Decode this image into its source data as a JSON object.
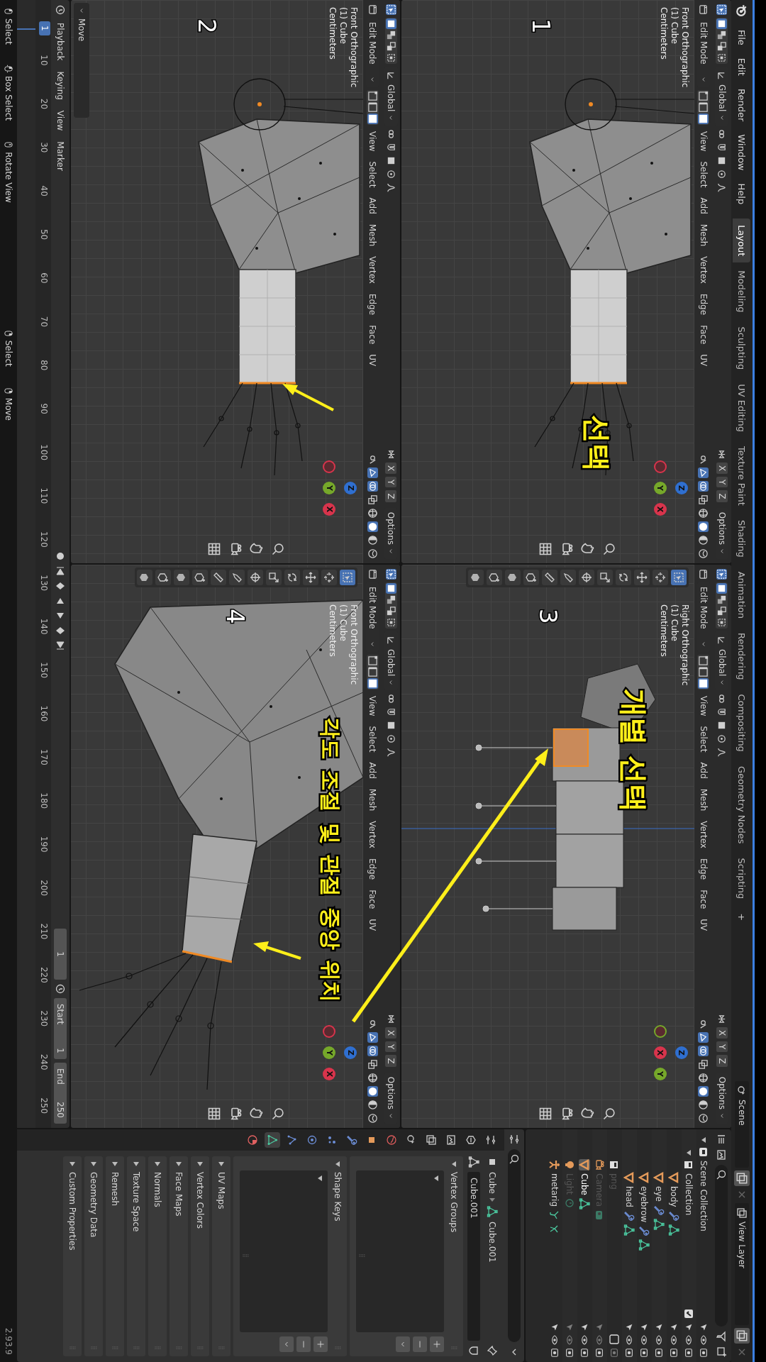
{
  "topbar": {
    "menus": [
      "File",
      "Edit",
      "Render",
      "Window",
      "Help"
    ],
    "workspaces": [
      {
        "label": "Layout",
        "selected": true
      },
      {
        "label": "Modeling",
        "selected": false
      },
      {
        "label": "Sculpting",
        "selected": false
      },
      {
        "label": "UV Editing",
        "selected": false
      },
      {
        "label": "Texture Paint",
        "selected": false
      },
      {
        "label": "Shading",
        "selected": false
      },
      {
        "label": "Animation",
        "selected": false
      },
      {
        "label": "Rendering",
        "selected": false
      },
      {
        "label": "Compositing",
        "selected": false
      },
      {
        "label": "Geometry Nodes",
        "selected": false
      },
      {
        "label": "Scripting",
        "selected": false
      }
    ],
    "add_workspace": "+",
    "scene": "Scene",
    "view_layer": "View Layer"
  },
  "viewports": [
    {
      "kind": "front",
      "number": "1",
      "view": "Front Orthographic",
      "object": "(1) Cube",
      "units": "Centimeters",
      "mode": "Edit Mode",
      "orientation": "Global",
      "options": "Options",
      "mirror_axes": [
        "X",
        "Y",
        "Z"
      ],
      "menus": [
        "View",
        "Select",
        "Add",
        "Mesh",
        "Vertex",
        "Edge",
        "Face",
        "UV"
      ],
      "select_modes": [
        {
          "kind": "vertex",
          "selected": false
        },
        {
          "kind": "edge",
          "selected": false
        },
        {
          "kind": "face",
          "selected": true
        }
      ],
      "shading": [
        {
          "kind": "wireframe",
          "selected": false
        },
        {
          "kind": "solid",
          "selected": true
        },
        {
          "kind": "material",
          "selected": false
        },
        {
          "kind": "rendered",
          "selected": false
        }
      ],
      "gizmo": [
        {
          "label": "Z",
          "kind": "up",
          "color": "#2f6fd0"
        },
        {
          "label": "Y",
          "kind": "center",
          "color": "#76a82a"
        },
        {
          "label": "X",
          "kind": "right",
          "color": "#d8344c"
        }
      ],
      "toolbar": false,
      "annotation": "선택"
    },
    {
      "kind": "right",
      "number": "3",
      "view": "Right Orthographic",
      "object": "(1) Cube",
      "units": "Centimeters",
      "mode": "Edit Mode",
      "orientation": "Global",
      "options": "Options",
      "mirror_axes": [
        "X",
        "Y",
        "Z"
      ],
      "menus": [
        "View",
        "Select",
        "Add",
        "Mesh",
        "Vertex",
        "Edge",
        "Face",
        "UV"
      ],
      "select_modes": [
        {
          "kind": "vertex",
          "selected": false
        },
        {
          "kind": "edge",
          "selected": false
        },
        {
          "kind": "face",
          "selected": true
        }
      ],
      "shading": [
        {
          "kind": "wireframe",
          "selected": false
        },
        {
          "kind": "solid",
          "selected": true
        },
        {
          "kind": "material",
          "selected": false
        },
        {
          "kind": "rendered",
          "selected": false
        }
      ],
      "gizmo": [
        {
          "label": "Z",
          "kind": "up",
          "color": "#2f6fd0"
        },
        {
          "label": "X",
          "kind": "center",
          "color": "#d8344c"
        },
        {
          "label": "Y",
          "kind": "right",
          "color": "#76a82a"
        }
      ],
      "toolbar": true,
      "annotation": "개별 선택"
    },
    {
      "kind": "front",
      "number": "2",
      "view": "Front Orthographic",
      "object": "(1) Cube",
      "units": "Centimeters",
      "mode": "Edit Mode",
      "orientation": "Global",
      "options": "Options",
      "mirror_axes": [
        "X",
        "Y",
        "Z"
      ],
      "menus": [
        "View",
        "Select",
        "Add",
        "Mesh",
        "Vertex",
        "Edge",
        "Face",
        "UV"
      ],
      "select_modes": [
        {
          "kind": "vertex",
          "selected": false
        },
        {
          "kind": "edge",
          "selected": false
        },
        {
          "kind": "face",
          "selected": true
        }
      ],
      "shading": [
        {
          "kind": "wireframe",
          "selected": false
        },
        {
          "kind": "solid",
          "selected": true
        },
        {
          "kind": "material",
          "selected": false
        },
        {
          "kind": "rendered",
          "selected": false
        }
      ],
      "gizmo": [
        {
          "label": "Z",
          "kind": "up",
          "color": "#2f6fd0"
        },
        {
          "label": "Y",
          "kind": "center",
          "color": "#76a82a"
        },
        {
          "label": "X",
          "kind": "right",
          "color": "#d8344c"
        }
      ],
      "toolbar": false,
      "operator_panel": "Move"
    },
    {
      "kind": "close",
      "number": "4",
      "view": "Front Orthographic",
      "object": "(1) Cube",
      "units": "Centimeters",
      "mode": "Edit Mode",
      "orientation": "Global",
      "options": "Options",
      "mirror_axes": [
        "X",
        "Y",
        "Z"
      ],
      "menus": [
        "View",
        "Select",
        "Add",
        "Mesh",
        "Vertex",
        "Edge",
        "Face",
        "UV"
      ],
      "select_modes": [
        {
          "kind": "vertex",
          "selected": false
        },
        {
          "kind": "edge",
          "selected": false
        },
        {
          "kind": "face",
          "selected": true
        }
      ],
      "shading": [
        {
          "kind": "wireframe",
          "selected": false
        },
        {
          "kind": "solid",
          "selected": true
        },
        {
          "kind": "material",
          "selected": false
        },
        {
          "kind": "rendered",
          "selected": false
        }
      ],
      "gizmo": [
        {
          "label": "Z",
          "kind": "up",
          "color": "#2f6fd0"
        },
        {
          "label": "Y",
          "kind": "center",
          "color": "#76a82a"
        },
        {
          "label": "X",
          "kind": "right",
          "color": "#d8344c"
        }
      ],
      "toolbar": true,
      "annotation": "각도 조절 및 관절 중앙 위치"
    }
  ],
  "timeline": {
    "menus": [
      "Playback",
      "Keying",
      "View",
      "Marker"
    ],
    "current_frame": "1",
    "start_label": "Start",
    "start": "1",
    "end_label": "End",
    "end": "250",
    "playhead": "1",
    "ruler": [
      "10",
      "20",
      "30",
      "40",
      "50",
      "60",
      "70",
      "80",
      "90",
      "100",
      "110",
      "120",
      "130",
      "140",
      "150",
      "160",
      "170",
      "180",
      "190",
      "200",
      "210",
      "220",
      "230",
      "240",
      "250"
    ]
  },
  "outliner": {
    "tree": [
      {
        "label": "Scene Collection",
        "kind": "scene",
        "selected": false,
        "children": [
          {
            "label": "Collection",
            "kind": "collection",
            "selected": false,
            "checked": true,
            "children": [
              {
                "label": "body",
                "kind": "mesh",
                "selected": false,
                "disabled": false
              },
              {
                "label": "eye",
                "kind": "mesh",
                "selected": false,
                "disabled": false
              },
              {
                "label": "eyebrow",
                "kind": "mesh",
                "selected": false,
                "disabled": false
              },
              {
                "label": "head",
                "kind": "mesh",
                "selected": false,
                "disabled": false
              }
            ]
          },
          {
            "label": "png",
            "kind": "collection",
            "selected": false,
            "checked": false
          },
          {
            "label": "Camera",
            "kind": "camera",
            "selected": false,
            "disabled": true
          },
          {
            "label": "Cube",
            "kind": "cube",
            "selected": true,
            "disabled": false
          },
          {
            "label": "Light",
            "kind": "light",
            "selected": false,
            "disabled": true
          },
          {
            "label": "metarig",
            "kind": "armature",
            "selected": false,
            "disabled": false
          }
        ]
      }
    ]
  },
  "properties": {
    "tabs": [
      {
        "kind": "tool",
        "selected": false
      },
      {
        "kind": "render",
        "selected": false
      },
      {
        "kind": "output",
        "selected": false
      },
      {
        "kind": "view-layer",
        "selected": false
      },
      {
        "kind": "scene",
        "selected": false
      },
      {
        "kind": "world",
        "selected": false
      },
      {
        "kind": "object",
        "selected": false
      },
      {
        "kind": "modifier",
        "selected": false
      },
      {
        "kind": "particles",
        "selected": false
      },
      {
        "kind": "physics",
        "selected": false
      },
      {
        "kind": "constraints",
        "selected": false
      },
      {
        "kind": "data",
        "selected": true
      },
      {
        "kind": "material",
        "selected": false
      }
    ],
    "object": "Cube",
    "mesh": "Cube.001",
    "datablock": "Cube.001",
    "panels": [
      {
        "title": "Vertex Groups",
        "expanded": true
      },
      {
        "title": "Shape Keys",
        "expanded": true
      },
      {
        "title": "UV Maps",
        "expanded": false
      },
      {
        "title": "Vertex Colors",
        "expanded": false
      },
      {
        "title": "Face Maps",
        "expanded": false
      },
      {
        "title": "Normals",
        "expanded": false
      },
      {
        "title": "Texture Space",
        "expanded": false
      },
      {
        "title": "Remesh",
        "expanded": false
      },
      {
        "title": "Geometry Data",
        "expanded": false
      },
      {
        "title": "Custom Properties",
        "expanded": false
      }
    ]
  },
  "status_bar": {
    "items": [
      {
        "kind": "left",
        "label": "Select"
      },
      {
        "kind": "drag",
        "label": "Box Select"
      },
      {
        "kind": "middle",
        "label": "Rotate View"
      },
      {
        "kind": "right",
        "label": "Select"
      },
      {
        "kind": "right",
        "label": "Move"
      }
    ],
    "version": "2.93.9"
  }
}
